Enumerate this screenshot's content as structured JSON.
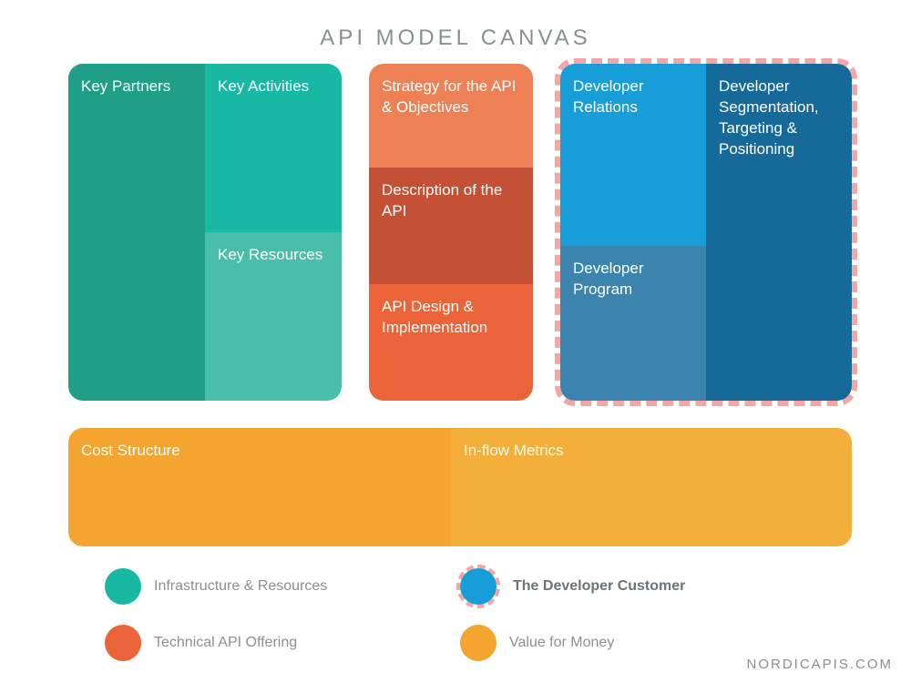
{
  "title": "API MODEL CANVAS",
  "blocks": {
    "partners": "Key Partners",
    "activities": "Key Activities",
    "resources": "Key Resources",
    "strategy": "Strategy for the API & Objectives",
    "description": "Description of the API",
    "design": "API Design & Implementation",
    "relations": "Developer Relations",
    "program": "Developer Program",
    "segmentation": "Developer Segmentation, Targeting & Positioning",
    "cost": "Cost Structure",
    "inflow": "In-flow Metrics"
  },
  "legend": {
    "infra": "Infrastructure & Resources",
    "tech": "Technical API Offering",
    "dev": "The Developer Customer",
    "value": "Value for Money"
  },
  "colors": {
    "teal_dark": "#1f9e88",
    "teal": "#18b8a2",
    "teal_light": "#49bfab",
    "orange_light": "#ed8155",
    "orange_dark": "#c45136",
    "orange": "#eb6439",
    "blue_light": "#179ed9",
    "blue_mid": "#3b84ad",
    "blue_dark": "#166a99",
    "yellow": "#f3a530",
    "yellow_light": "#f4ae3a",
    "highlight_dash": "#f2a6a6"
  },
  "footer": "NORDICAPIS.COM"
}
